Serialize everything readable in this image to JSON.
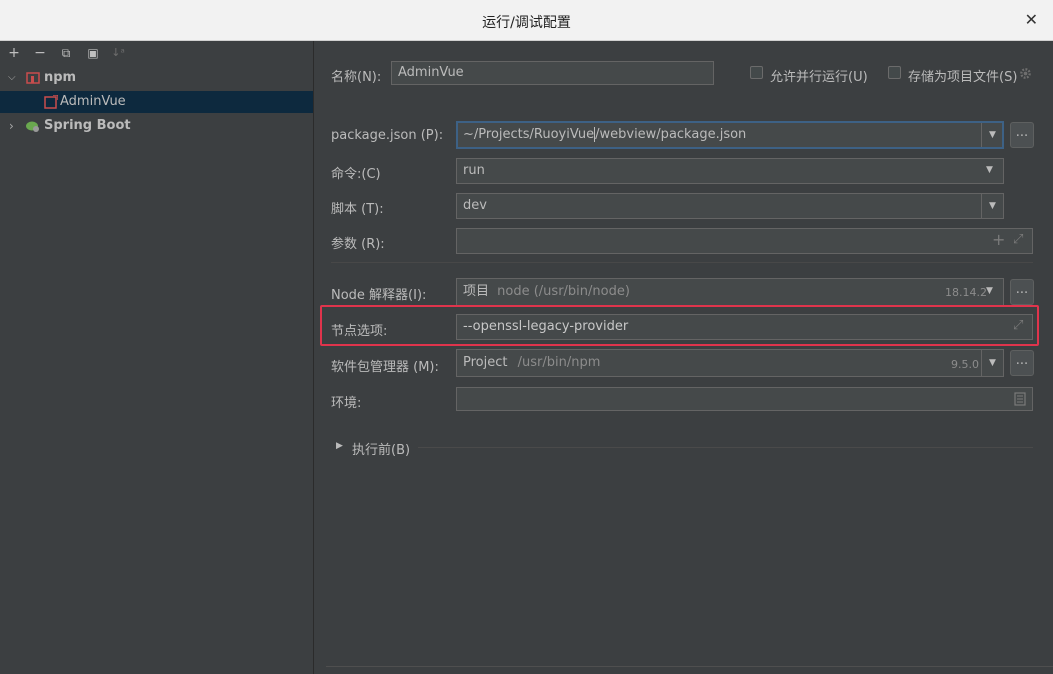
{
  "window": {
    "title": "运行/调试配置"
  },
  "toolbar": {
    "add": "+",
    "remove": "−",
    "copy": "⧉",
    "folder": "▣",
    "sort": "↓ᵃ"
  },
  "tree": {
    "npm_label": "npm",
    "adminvue_label": "AdminVue",
    "spring_label": "Spring Boot"
  },
  "form": {
    "name_label": "名称(N):",
    "name_value": "AdminVue",
    "parallel_label": "允许并行运行(U)",
    "store_label": "存储为项目文件(S)",
    "package_label": "package.json (P):",
    "package_value_a": "~/Projects/RuoyiVue",
    "package_value_b": "/webview/package.json",
    "command_label": "命令:(C)",
    "command_value": "run",
    "script_label": "脚本 (T):",
    "script_value": "dev",
    "args_label": "参数 (R):",
    "args_value": "",
    "node_label": "Node 解释器(I):",
    "node_project": "项目",
    "node_path": "node (/usr/bin/node)",
    "node_version": "18.14.2",
    "nodeopt_label": "节点选项:",
    "nodeopt_value": "--openssl-legacy-provider",
    "pm_label": "软件包管理器 (M):",
    "pm_project": "Project",
    "pm_path": "/usr/bin/npm",
    "pm_version": "9.5.0",
    "env_label": "环境:",
    "env_value": "",
    "before_label": "执行前(B)",
    "dots": "..."
  },
  "colors": {
    "highlight": "#e0344c",
    "selection": "#0d293e",
    "focus": "#3d6185"
  }
}
